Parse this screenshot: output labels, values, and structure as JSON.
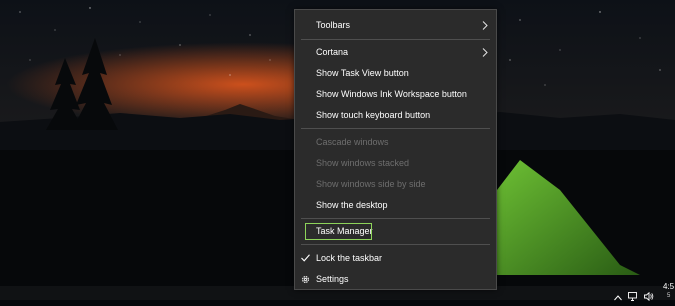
{
  "context_menu": {
    "items": [
      {
        "label": "Toolbars",
        "submenu": true,
        "enabled": true
      },
      {
        "label": "Cortana",
        "submenu": true,
        "enabled": true
      },
      {
        "label": "Show Task View button",
        "enabled": true
      },
      {
        "label": "Show Windows Ink Workspace button",
        "enabled": true
      },
      {
        "label": "Show touch keyboard button",
        "enabled": true
      },
      {
        "label": "Cascade windows",
        "enabled": false
      },
      {
        "label": "Show windows stacked",
        "enabled": false
      },
      {
        "label": "Show windows side by side",
        "enabled": false
      },
      {
        "label": "Show the desktop",
        "enabled": true
      },
      {
        "label": "Task Manager",
        "enabled": true,
        "highlighted": true
      },
      {
        "label": "Lock the taskbar",
        "enabled": true,
        "checked": true,
        "icon": "checkmark-icon"
      },
      {
        "label": "Settings",
        "enabled": true,
        "icon": "gear-icon"
      }
    ],
    "highlight_color": "#8dd35a"
  },
  "tray": {
    "clock_time": "4:5",
    "clock_date": "5",
    "icons": [
      "chevron-up-icon",
      "network-icon",
      "volume-icon"
    ]
  },
  "colors": {
    "menu_bg": "#2b2b2b",
    "menu_text": "#ffffff",
    "menu_disabled": "#6e6e6e",
    "tent_green": "#5fbf2a",
    "sunset_orange": "#e0561c"
  }
}
